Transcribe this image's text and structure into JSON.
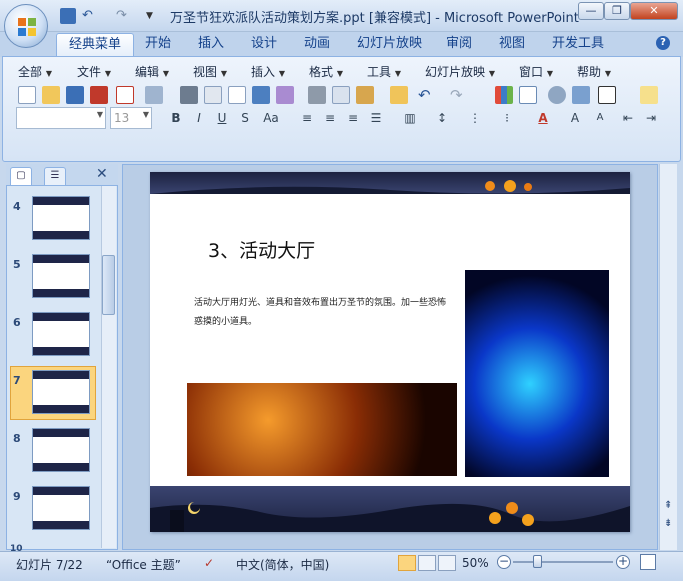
{
  "window": {
    "title": "万圣节狂欢派队活动策划方案.ppt [兼容模式] - Microsoft PowerPoint",
    "minimize_label": "—",
    "restore_label": "❐",
    "close_label": "✕"
  },
  "ribbon_tabs": [
    {
      "label": "经典菜单"
    },
    {
      "label": "开始"
    },
    {
      "label": "插入"
    },
    {
      "label": "设计"
    },
    {
      "label": "动画"
    },
    {
      "label": "幻灯片放映"
    },
    {
      "label": "审阅"
    },
    {
      "label": "视图"
    },
    {
      "label": "开发工具"
    }
  ],
  "help_glyph": "?",
  "classic_menu": [
    {
      "label": "全部"
    },
    {
      "label": "文件"
    },
    {
      "label": "编辑"
    },
    {
      "label": "视图"
    },
    {
      "label": "插入"
    },
    {
      "label": "格式"
    },
    {
      "label": "工具"
    },
    {
      "label": "幻灯片放映"
    },
    {
      "label": "窗口"
    },
    {
      "label": "帮助"
    }
  ],
  "format_bar": {
    "font_name": "",
    "font_size": "13",
    "bold": "B",
    "italic": "I",
    "underline": "U",
    "strike": "S",
    "case": "Aa"
  },
  "thumbnails": [
    {
      "num": "4"
    },
    {
      "num": "5"
    },
    {
      "num": "6"
    },
    {
      "num": "7"
    },
    {
      "num": "8"
    },
    {
      "num": "9"
    },
    {
      "num": "10"
    }
  ],
  "slide": {
    "title": "3、活动大厅",
    "body": "活动大厅用灯光、道具和音效布置出万圣节的氛围。加一些恐怖惑摸的小道具。"
  },
  "status": {
    "slide_pos": "幻灯片 7/22",
    "theme": "“Office 主题”",
    "language": "中文(简体，中国)",
    "zoom": "50%"
  },
  "colors": {
    "accent": "#15428b",
    "ribbon_bg": "#dce8f6",
    "selected_thumb": "#fbd57e"
  }
}
